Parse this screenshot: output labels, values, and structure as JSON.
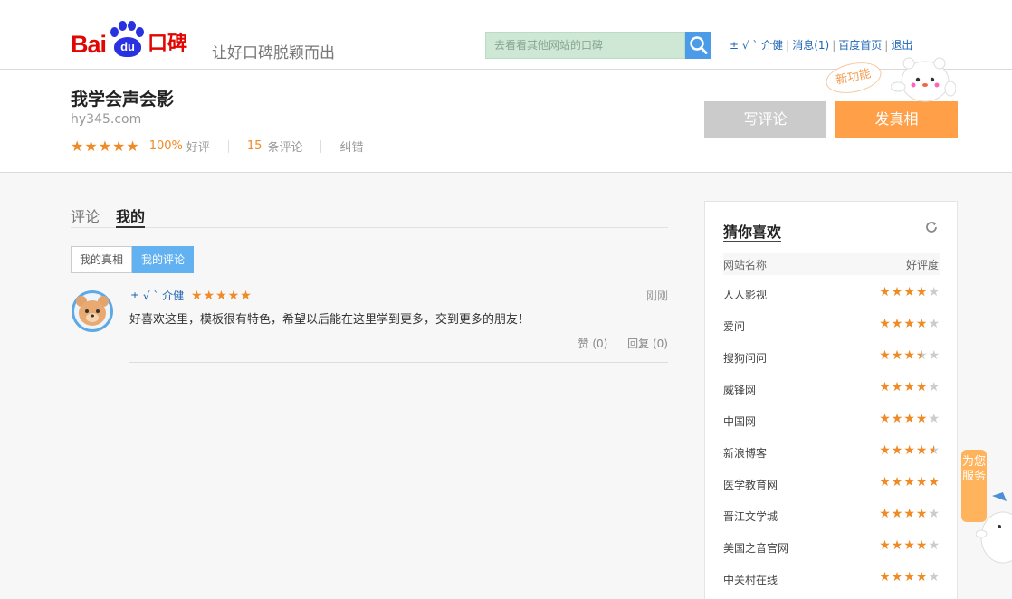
{
  "header": {
    "logo": {
      "bai": "Bai",
      "du": "du",
      "koubei": "口碑"
    },
    "slogan": "让好口碑脱颖而出",
    "search": {
      "placeholder": "去看看其他网站的口碑",
      "icon": "search-icon"
    },
    "user": {
      "name": "±  √    ˋ 介健",
      "messages": "消息(1)",
      "baidu_home": "百度首页",
      "logout": "退出"
    }
  },
  "site": {
    "title": "我学会声会影",
    "domain": "hy345.com",
    "rating_stars": 5,
    "positive_rate": "100%",
    "positive_label": "好评",
    "review_count": "15",
    "review_label": "条评论",
    "report": "纠错",
    "write_review": "写评论",
    "post_truth": "发真相",
    "new_feature": "新功能"
  },
  "main": {
    "tabs": [
      {
        "label": "评论"
      },
      {
        "label": "我的"
      }
    ],
    "subtabs": [
      {
        "label": "我的真相"
      },
      {
        "label": "我的评论"
      }
    ],
    "review": {
      "user": "±  √    ˋ 介健",
      "stars": 5,
      "time": "刚刚",
      "text": "好喜欢这里，模板很有特色，希望以后能在这里学到更多，交到更多的朋友！",
      "like": "赞 (0)",
      "reply": "回复 (0)"
    }
  },
  "sidebar": {
    "title": "猜你喜欢",
    "col_name": "网站名称",
    "col_rating": "好评度",
    "items": [
      {
        "name": "人人影视",
        "rating": 4
      },
      {
        "name": "爱问",
        "rating": 4
      },
      {
        "name": "搜狗问问",
        "rating": 3.5
      },
      {
        "name": "威锋网",
        "rating": 4
      },
      {
        "name": "中国网",
        "rating": 4
      },
      {
        "name": "新浪博客",
        "rating": 4.5
      },
      {
        "name": "医学教育网",
        "rating": 5
      },
      {
        "name": "晋江文学城",
        "rating": 4
      },
      {
        "name": "美国之音官网",
        "rating": 4
      },
      {
        "name": "中关村在线",
        "rating": 4
      }
    ]
  },
  "service": {
    "label": "为您服务"
  },
  "colors": {
    "accent_orange": "#f08a25",
    "button_orange": "#ff9f47",
    "link_blue": "#1f66b5",
    "tab_blue": "#62b1f0"
  }
}
